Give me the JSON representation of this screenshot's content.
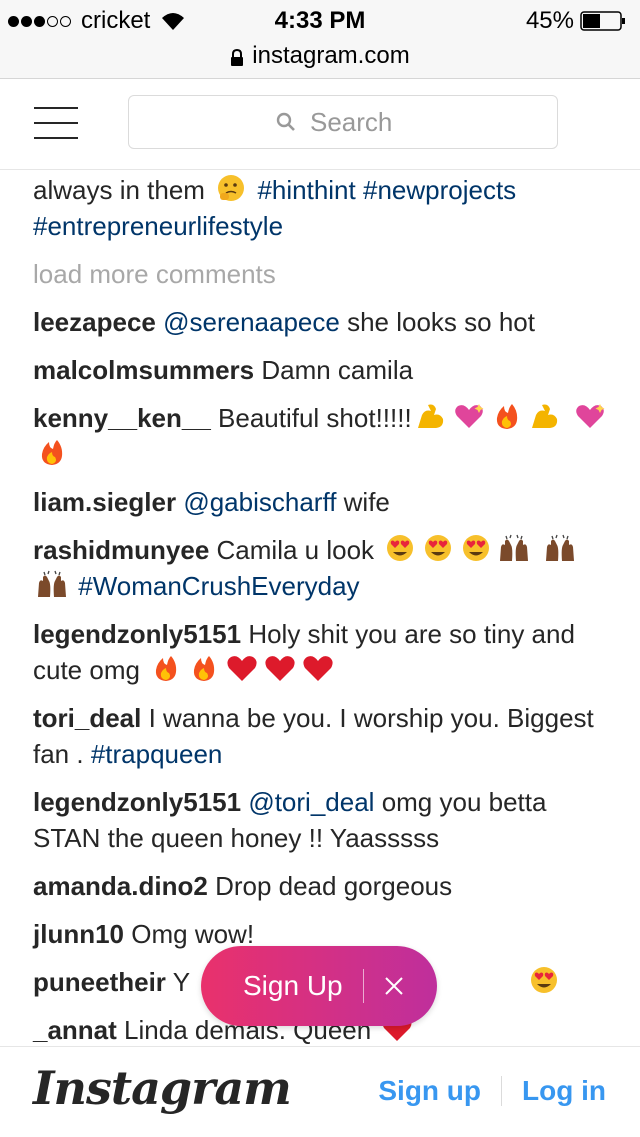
{
  "status_bar": {
    "carrier": "cricket",
    "time": "4:33 PM",
    "battery": "45%",
    "signal_bars": 3,
    "signal_total": 5
  },
  "browser": {
    "url": "instagram.com"
  },
  "header": {
    "search_placeholder": "Search"
  },
  "caption": {
    "text": "always in them",
    "hashtags": [
      "#hinthint",
      "#newprojects",
      "#entrepreneurlifestyle"
    ]
  },
  "load_more_label": "load more comments",
  "comments": [
    {
      "user": "leezapece",
      "mention": "@serenaapece",
      "text": "she looks so hot"
    },
    {
      "user": "malcolmsummers",
      "text": "Damn camila"
    },
    {
      "user": "kenny__ken__",
      "text": "Beautiful shot!!!!!"
    },
    {
      "user": "liam.siegler",
      "mention": "@gabischarff",
      "text": "wife"
    },
    {
      "user": "rashidmunyee",
      "text": "Camila u look",
      "hashtag": "#WomanCrushEveryday"
    },
    {
      "user": "legendzonly5151",
      "text": "Holy shit you are so tiny and cute omg"
    },
    {
      "user": "tori_deal",
      "text": "I wanna be you. I worship you. Biggest fan .",
      "hashtag": "#trapqueen"
    },
    {
      "user": "legendzonly5151",
      "mention": "@tori_deal",
      "text": "omg you betta STAN the queen honey !! Yaasssss"
    },
    {
      "user": "amanda.dino2",
      "text": "Drop dead gorgeous"
    },
    {
      "user": "jlunn10",
      "text": "Omg wow!"
    },
    {
      "user": "puneetheir",
      "text": "Y"
    },
    {
      "user": "_annat",
      "text": "Linda demais. Queen"
    }
  ],
  "signup_popup": {
    "label": "Sign Up"
  },
  "footer": {
    "logo": "Instagram",
    "signup": "Sign up",
    "login": "Log in"
  },
  "colors": {
    "link": "#003569",
    "muted": "#a8a8a8",
    "accent": "#3897f0",
    "pill_start": "#e9316c",
    "pill_end": "#bf2f9c"
  },
  "icons": [
    "wifi-icon",
    "battery-icon",
    "lock-icon",
    "menu-icon",
    "search-icon",
    "close-icon",
    "thinking-emoji",
    "flexed-biceps-emoji",
    "sparkling-heart-emoji",
    "fire-emoji",
    "heart-eyes-emoji",
    "raising-hands-emoji",
    "red-heart-emoji"
  ]
}
